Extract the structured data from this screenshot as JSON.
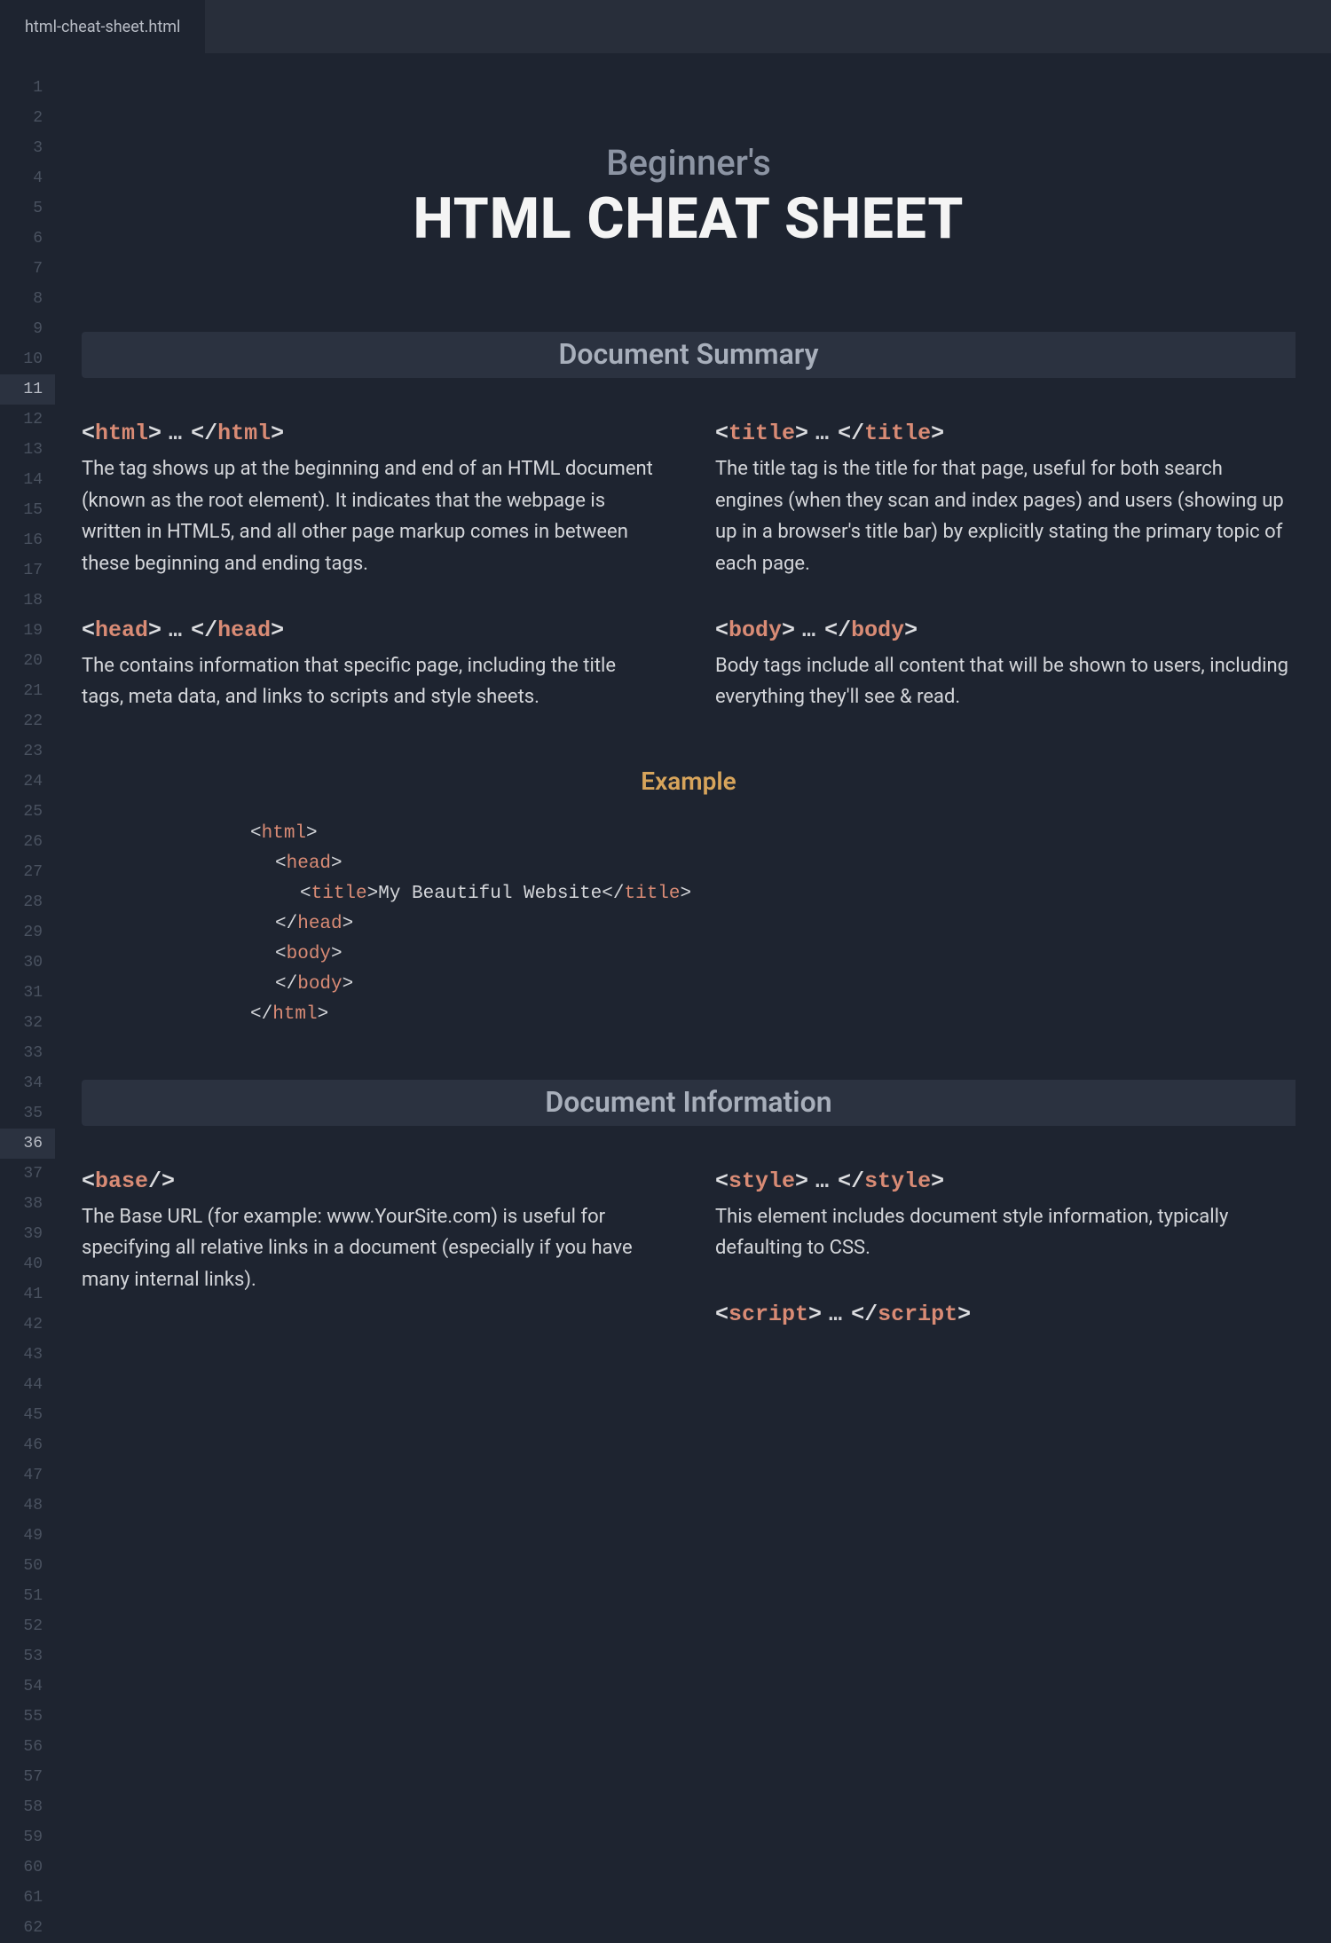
{
  "tab": {
    "filename": "html-cheat-sheet.html"
  },
  "gutter": {
    "lines": 62,
    "highlighted": [
      11,
      36
    ]
  },
  "hero": {
    "subtitle": "Beginner's",
    "title": "HTML CHEAT SHEET"
  },
  "section1": {
    "heading": "Document Summary",
    "left": [
      {
        "open": "html",
        "close": "html",
        "dots": true,
        "desc": "The tag shows up at the beginning and end of an HTML document (known as the root element). It indicates that the webpage is written in HTML5, and all other page markup comes in between these beginning and ending tags."
      },
      {
        "open": "head",
        "close": "head",
        "dots": true,
        "desc": "The contains information that specific page, including the title tags, meta data, and links to scripts and style sheets."
      }
    ],
    "right": [
      {
        "open": "title",
        "close": "title",
        "dots": true,
        "desc": "The title tag is the title for that page, useful for both search engines (when they scan and index pages) and users (showing up up in a browser's title bar) by explicitly stating the primary topic of each page."
      },
      {
        "open": "body",
        "close": "body",
        "dots": true,
        "desc": "Body tags include all content that will be shown to users, including everything they'll see & read."
      }
    ]
  },
  "example": {
    "heading": "Example",
    "lines": [
      {
        "indent": 0,
        "parts": [
          {
            "b": "<"
          },
          {
            "t": "html"
          },
          {
            "b": ">"
          }
        ]
      },
      {
        "indent": 1,
        "parts": [
          {
            "b": "<"
          },
          {
            "t": "head"
          },
          {
            "b": ">"
          }
        ]
      },
      {
        "indent": 2,
        "parts": [
          {
            "b": "<"
          },
          {
            "t": "title"
          },
          {
            "b": ">My Beautiful Website</"
          },
          {
            "t": "title"
          },
          {
            "b": ">"
          }
        ]
      },
      {
        "indent": 1,
        "parts": [
          {
            "b": "</"
          },
          {
            "t": "head"
          },
          {
            "b": ">"
          }
        ]
      },
      {
        "indent": 1,
        "parts": [
          {
            "b": "<"
          },
          {
            "t": "body"
          },
          {
            "b": ">"
          }
        ]
      },
      {
        "indent": 1,
        "parts": [
          {
            "b": ""
          }
        ]
      },
      {
        "indent": 1,
        "parts": [
          {
            "b": "</"
          },
          {
            "t": "body"
          },
          {
            "b": ">"
          }
        ]
      },
      {
        "indent": 0,
        "parts": [
          {
            "b": "</"
          },
          {
            "t": "html"
          },
          {
            "b": ">"
          }
        ]
      }
    ]
  },
  "section2": {
    "heading": "Document Information",
    "left": [
      {
        "open": "base",
        "selfclose": true,
        "desc": "The Base URL (for example: www.YourSite.com) is useful for specifying all relative links in a document (especially if you have many internal links)."
      }
    ],
    "right": [
      {
        "open": "style",
        "close": "style",
        "dots": true,
        "desc": "This element includes document style information, typically defaulting to CSS."
      },
      {
        "open": "script",
        "close": "script",
        "dots": true,
        "desc": ""
      }
    ]
  }
}
